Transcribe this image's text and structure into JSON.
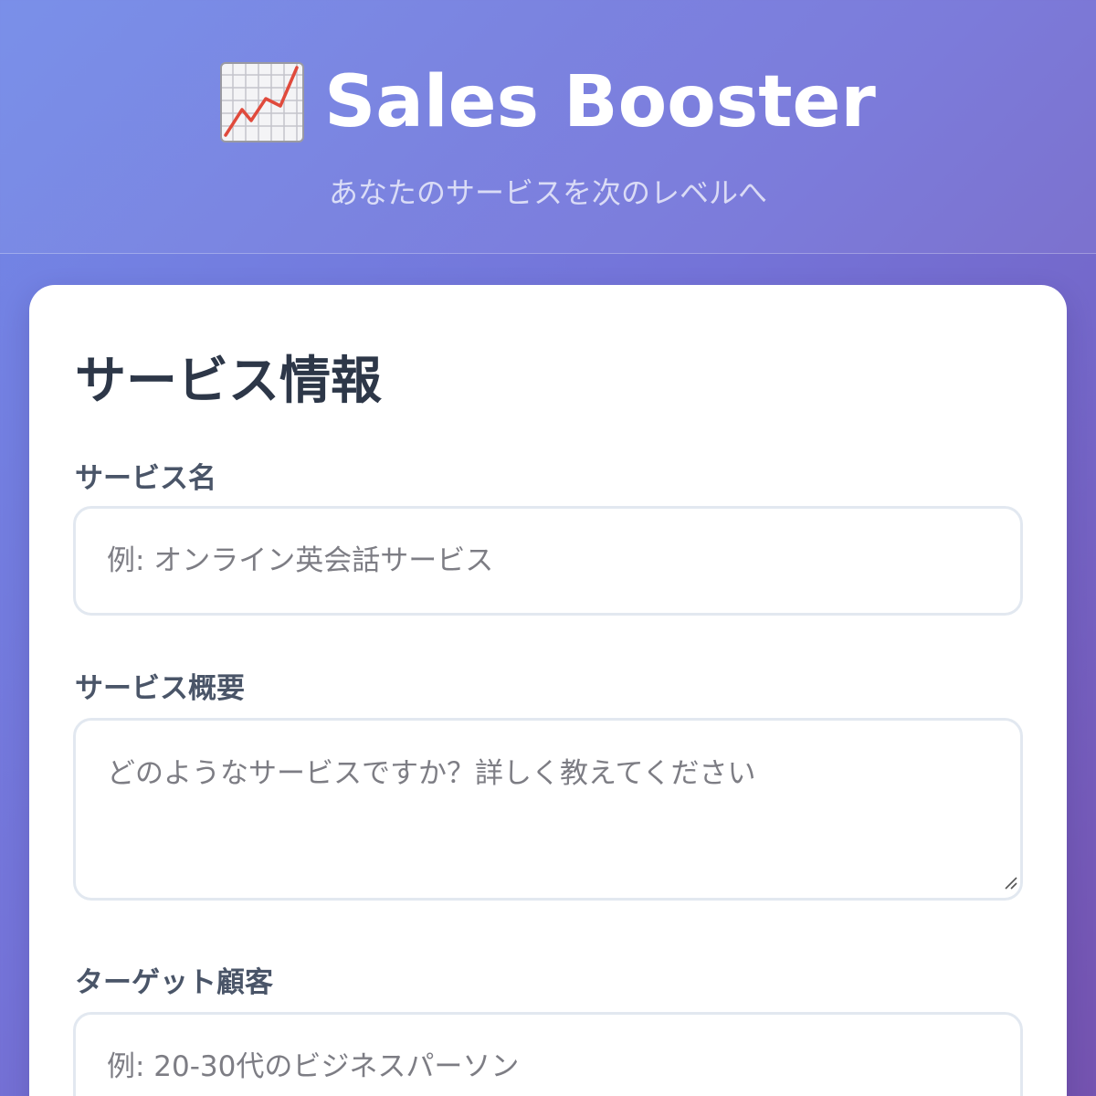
{
  "header": {
    "icon": "chart-increasing-icon",
    "title": "Sales Booster",
    "tagline": "あなたのサービスを次のレベルへ"
  },
  "form": {
    "section_title": "サービス情報",
    "fields": [
      {
        "label": "サービス名",
        "type": "text",
        "value": "",
        "placeholder": "例: オンライン英会話サービス"
      },
      {
        "label": "サービス概要",
        "type": "textarea",
        "value": "",
        "placeholder": "どのようなサービスですか？詳しく教えてください"
      },
      {
        "label": "ターゲット顧客",
        "type": "text",
        "value": "",
        "placeholder": "例: 20-30代のビジネスパーソン"
      }
    ]
  },
  "colors": {
    "gradient_start": "#7289e8",
    "gradient_end": "#7553b0",
    "card_background": "#ffffff",
    "heading_text": "#2d3748",
    "label_text": "#4a5568",
    "input_border": "#e2e8f0"
  }
}
